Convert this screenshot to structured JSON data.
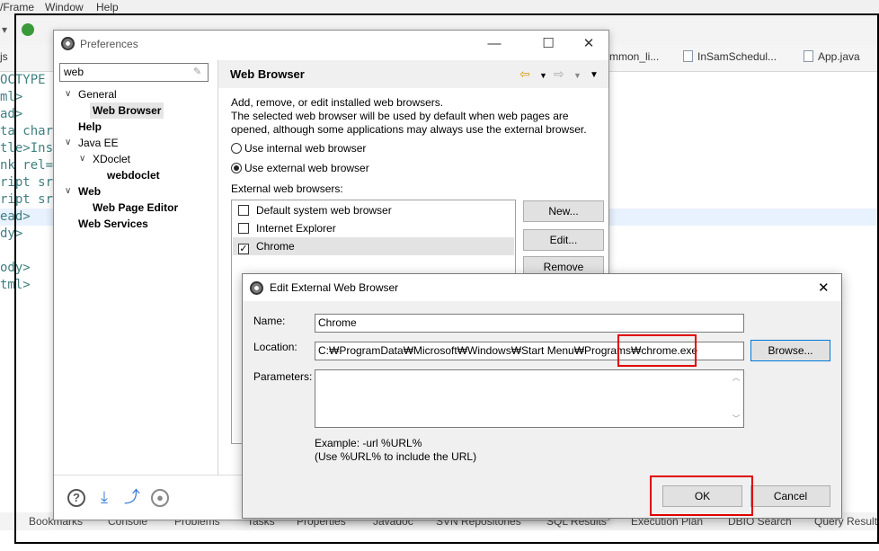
{
  "ide": {
    "menu": [
      "/Frame",
      "Window",
      "Help"
    ],
    "tabs": [
      "js",
      "mmon_li...",
      "InSamSchedul...",
      "App.java"
    ],
    "code_lines": [
      "OCTYPE",
      "ml>",
      "ad>",
      "ta char",
      "tle>Ins",
      "nk rel=",
      "ript sr",
      "ript sr",
      "ead>",
      "dy>",
      "",
      "ody>",
      "tml>"
    ],
    "bottom_tabs": [
      "Bookmarks",
      "Console",
      "Problems",
      "Tasks",
      "Properties",
      "Javadoc",
      "SVN Repositories",
      "SQL Results",
      "Execution Plan",
      "DBIO Search",
      "Query Result"
    ]
  },
  "preferences": {
    "title": "Preferences",
    "filter_value": "web",
    "tree": [
      {
        "label": "General",
        "expanded": true
      },
      {
        "label": "Web Browser",
        "selected": true
      },
      {
        "label": "Help"
      },
      {
        "label": "Java EE",
        "expanded": true
      },
      {
        "label": "XDoclet",
        "expanded": true
      },
      {
        "label": "webdoclet"
      },
      {
        "label": "Web",
        "expanded": true
      },
      {
        "label": "Web Page Editor"
      },
      {
        "label": "Web Services"
      }
    ],
    "page": {
      "title": "Web Browser",
      "description_1": "Add, remove, or edit installed web browsers.",
      "description_2": "The selected web browser will be used by default when web pages are opened, although some applications may always use the external browser.",
      "radio_internal": "Use internal web browser",
      "radio_external": "Use external web browser",
      "selected_radio": "external",
      "external_label": "External web browsers:",
      "browsers": [
        {
          "name": "Default system web browser",
          "checked": false
        },
        {
          "name": "Internet Explorer",
          "checked": false
        },
        {
          "name": "Chrome",
          "checked": true
        }
      ],
      "buttons": {
        "new": "New...",
        "edit": "Edit...",
        "remove": "Remove"
      }
    }
  },
  "edit_dialog": {
    "title": "Edit External Web Browser",
    "name_label": "Name:",
    "name_value": "Chrome",
    "location_label": "Location:",
    "location_value": "C:₩ProgramData₩Microsoft₩Windows₩Start Menu₩Programs₩chrome.exe",
    "browse_button": "Browse...",
    "parameters_label": "Parameters:",
    "parameters_value": "",
    "example_1": "Example: -url %URL%",
    "example_2": "(Use %URL% to include the URL)",
    "ok_button": "OK",
    "cancel_button": "Cancel"
  },
  "colors": {
    "highlight": "#e00000",
    "focus": "#0078d7",
    "selection": "#e5e5e5"
  }
}
